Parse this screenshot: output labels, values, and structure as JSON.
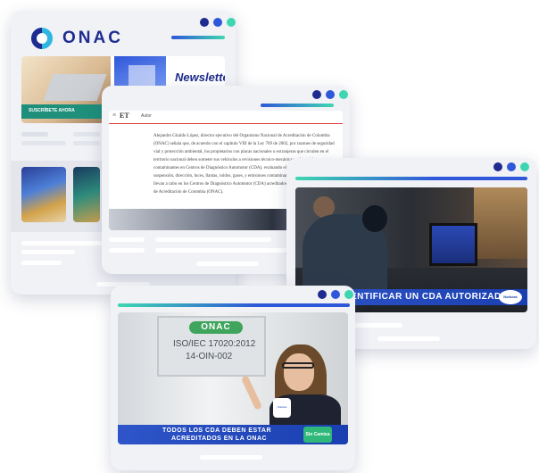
{
  "colors": {
    "navy": "#1e2b8f",
    "blue": "#2f57d9",
    "teal": "#3ed6b1",
    "frame": "#f1f2f6"
  },
  "window1": {
    "logo_text": "ONAC",
    "hero_heading": "Newsletter",
    "hero_button": "SUSCRÍBETE AHORA"
  },
  "window2": {
    "header_text": "Autor",
    "article_text": "Alejandro Giraldo López, director ejecutivo del Organismo Nacional de Acreditación de Colombia (ONAC) señala que, de acuerdo con el capítulo VIII de la Ley 769 de 2002, por razones de seguridad vial y protección ambiental, los propietarios con placas nacionales o extranjeras que circulen en el territorio nacional deben someter sus vehículos a revisiones técnico-mecánicas y de emisiones contaminantes en Centros de Diagnóstico Automotor (CDA), evaluando el estado de frenos, suspensión, dirección, luces, llantas, ruidos, gases, y emisiones contaminantes. Estas revisiones se llevan a cabo en los Centros de Diagnóstico Automotor (CDA) acreditados por el Organismo Nacional de Acreditación de Colombia (ONAC)."
  },
  "window3": {
    "banner_text": "ENTIFICAR UN CDA AUTORIZADO?",
    "channel_logo": "Noticias"
  },
  "window4": {
    "plaque_logo": "ONAC",
    "plaque_line1": "ISO/IEC 17020:2012",
    "plaque_line2": "14-OIN-002",
    "caption_line1": "TODOS LOS CDA DEBEN ESTAR",
    "caption_line2": "ACREDITADOS EN LA ONAC",
    "mic_label": "Noticias",
    "show_logo": "Sin Camisa"
  }
}
